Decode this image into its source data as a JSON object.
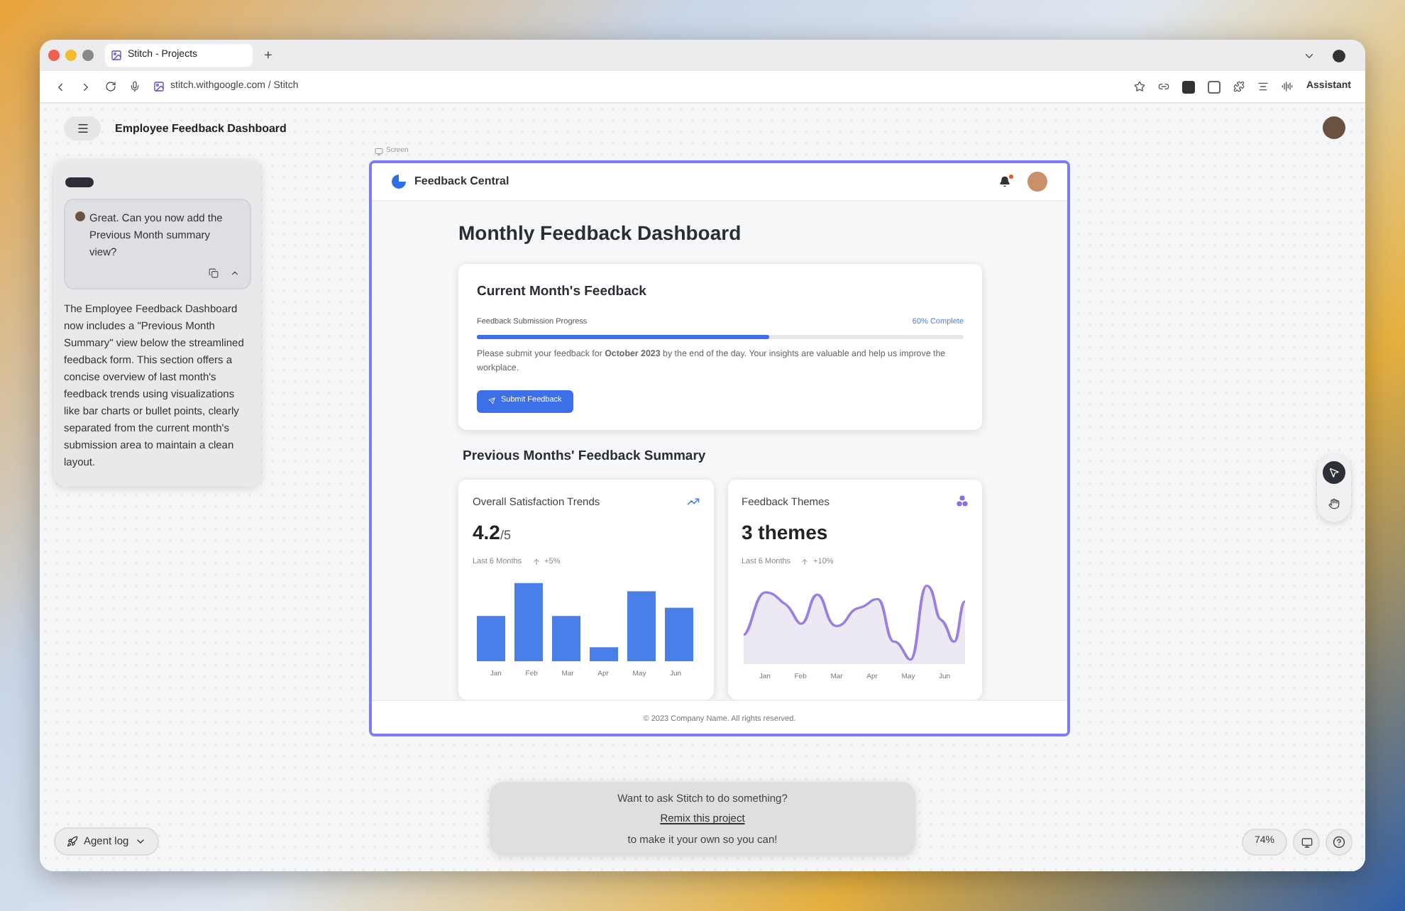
{
  "browser": {
    "tab_title": "Stitch - Projects",
    "new_tab": "+",
    "url": "stitch.withgoogle.com / Stitch",
    "assistant": "Assistant"
  },
  "app": {
    "project_title": "Employee Feedback Dashboard"
  },
  "chat": {
    "user_message": "Great. Can you now add the Previous Month summary view?",
    "expanded": true,
    "reply": "The Employee Feedback Dashboard now includes a \"Previous Month Summary\" view below the streamlined feedback form. This section offers a concise overview of last month's feedback trends using visualizations like bar charts or bullet points, clearly separated from the current month's submission area to maintain a clean layout."
  },
  "screen": {
    "label": "Screen",
    "brand": "Feedback Central",
    "has_notification": true,
    "page_title": "Monthly Feedback Dashboard",
    "current": {
      "title": "Current Month's Feedback",
      "progress_label": "Feedback Submission Progress",
      "progress_reading": "60% Complete",
      "level": 0.6,
      "message": "Please submit your feedback for **October 2023** by the end of the day. Your insights are valuable and help us improve the workplace.",
      "button": "Submit Feedback"
    },
    "summary_title": "Previous Months' Feedback Summary",
    "cards": [
      {
        "kind": "bar",
        "title": "Overall Satisfaction Trends",
        "value": "4.2",
        "unit": "/5",
        "period": "Last 6 Months",
        "change": "+5%",
        "months": [
          "Jan",
          "Feb",
          "Mar",
          "Apr",
          "May",
          "Jun"
        ]
      },
      {
        "kind": "wave",
        "title": "Feedback Themes",
        "value": "3 themes",
        "period": "Last 6 Months",
        "change": "+10%",
        "months": [
          "Jan",
          "Feb",
          "Mar",
          "Apr",
          "May",
          "Jun"
        ]
      }
    ],
    "footer": "© 2023 Company Name. All rights reserved."
  },
  "prompt": {
    "question": "Want to ask Stitch to do something?",
    "link": "Remix this project",
    "note": "to make it your own so you can!"
  },
  "tools": [
    {
      "kind": "pointer",
      "selected": true
    },
    {
      "kind": "hand",
      "selected": false
    }
  ],
  "agent_log": "Agent log",
  "zoom": "74%"
}
